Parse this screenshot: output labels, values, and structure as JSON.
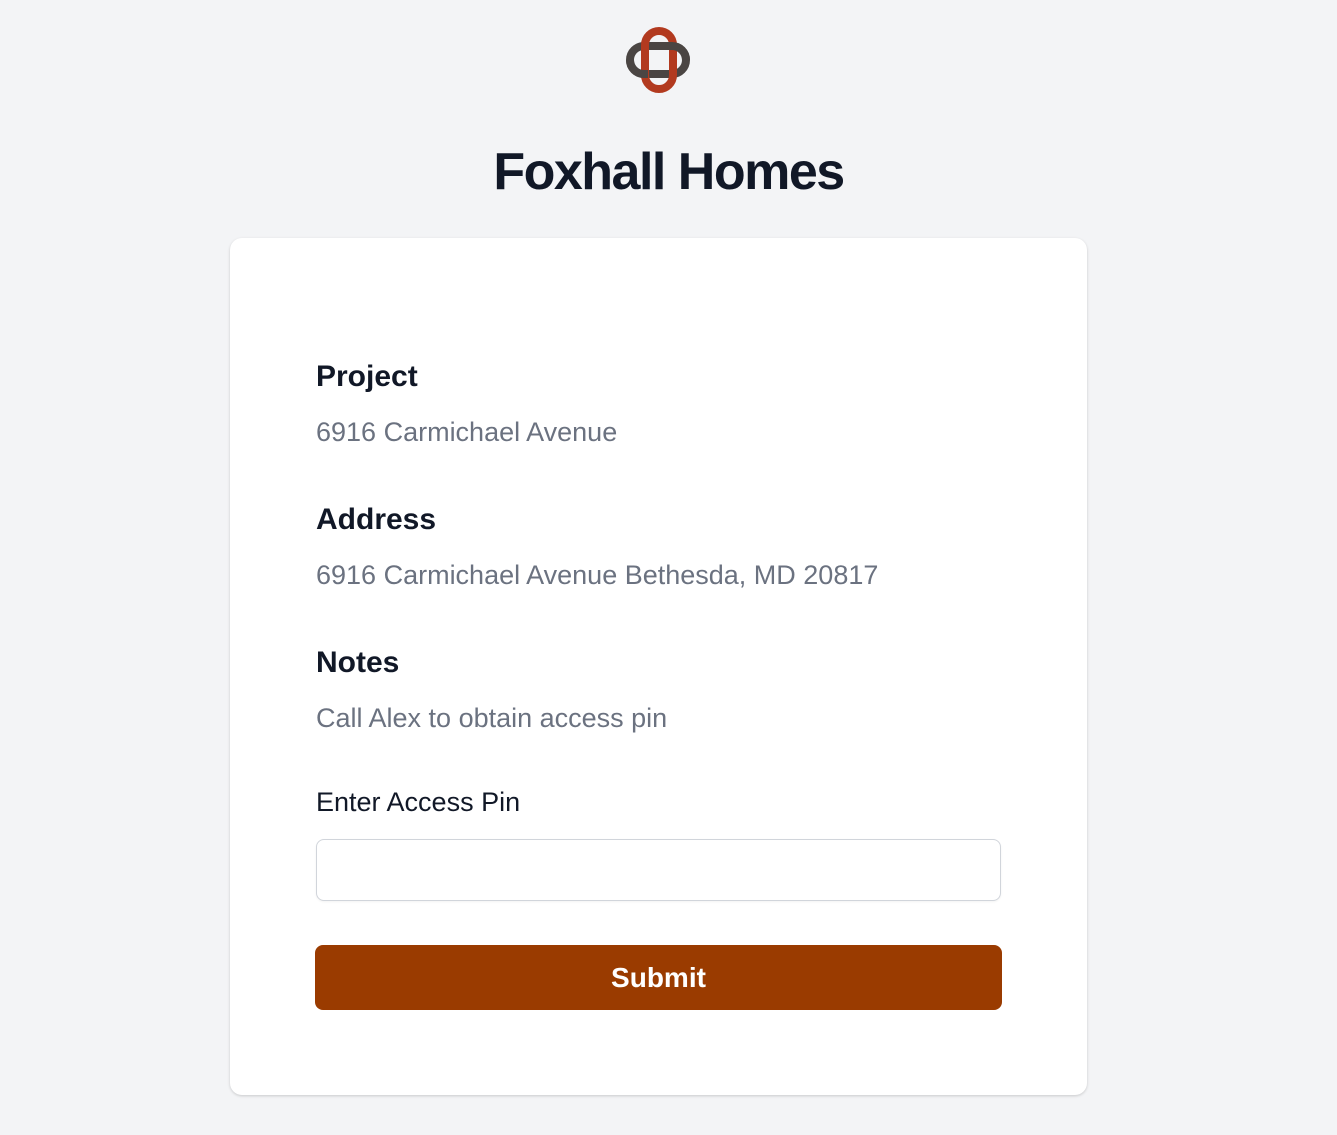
{
  "brand": {
    "logo_icon": "foxhall-chain-link-logo-icon",
    "title": "Foxhall Homes",
    "colors": {
      "accent": "#9a3b00",
      "logo_red": "#b23a1f",
      "logo_dark": "#4a4543",
      "background": "#f3f4f6"
    }
  },
  "details": {
    "project": {
      "label": "Project",
      "value": "6916 Carmichael Avenue"
    },
    "address": {
      "label": "Address",
      "value": "6916 Carmichael Avenue Bethesda, MD 20817"
    },
    "notes": {
      "label": "Notes",
      "value": "Call Alex to obtain access pin"
    }
  },
  "form": {
    "pin_label": "Enter Access Pin",
    "pin_value": "",
    "pin_placeholder": "",
    "submit_label": "Submit"
  }
}
